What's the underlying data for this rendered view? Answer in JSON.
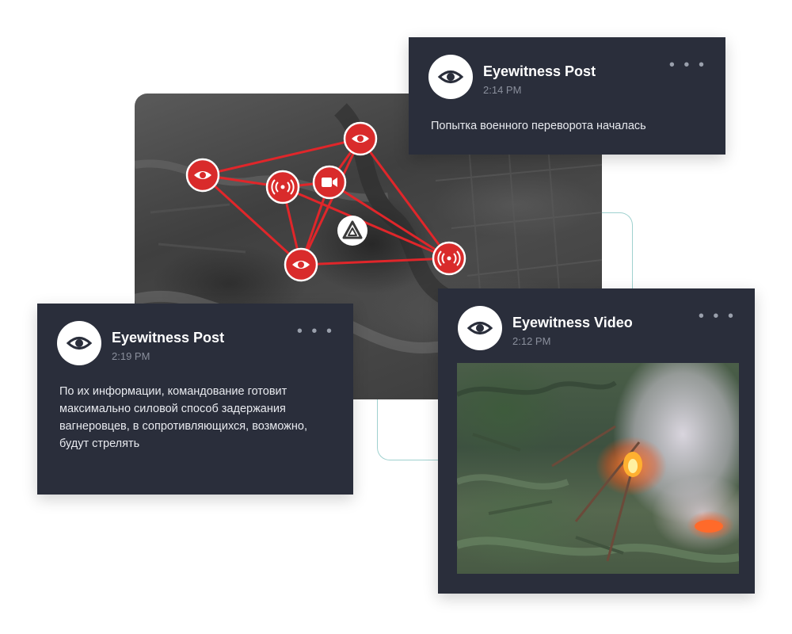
{
  "colors": {
    "card_bg": "#2a2e3b",
    "marker_red": "#d92b2b",
    "link_line": "#e0262a",
    "accent_teal": "#9fd1cf",
    "meta_gray": "#8a8f9c"
  },
  "map": {
    "markers": [
      {
        "id": "eye-1",
        "icon": "eye-icon"
      },
      {
        "id": "eye-2",
        "icon": "eye-icon"
      },
      {
        "id": "eye-3",
        "icon": "eye-icon"
      },
      {
        "id": "signal-1",
        "icon": "broadcast-icon"
      },
      {
        "id": "signal-2",
        "icon": "broadcast-icon"
      },
      {
        "id": "camera-1",
        "icon": "video-camera-icon"
      },
      {
        "id": "logo",
        "icon": "triangle-logo-icon"
      }
    ]
  },
  "cards": [
    {
      "author": "Eyewitness Post",
      "time": "2:14 PM",
      "more": "• • •",
      "text": "Попытка военного переворота началась"
    },
    {
      "author": "Eyewitness Post",
      "time": "2:19 PM",
      "more": "• • •",
      "text": "По их информации, командование готовит максимально силовой способ задержания вагнеровцев, в сопротивляющихся, возможно, будут стрелять"
    },
    {
      "author": "Eyewitness Video",
      "time": "2:12 PM",
      "more": "• • •"
    }
  ]
}
